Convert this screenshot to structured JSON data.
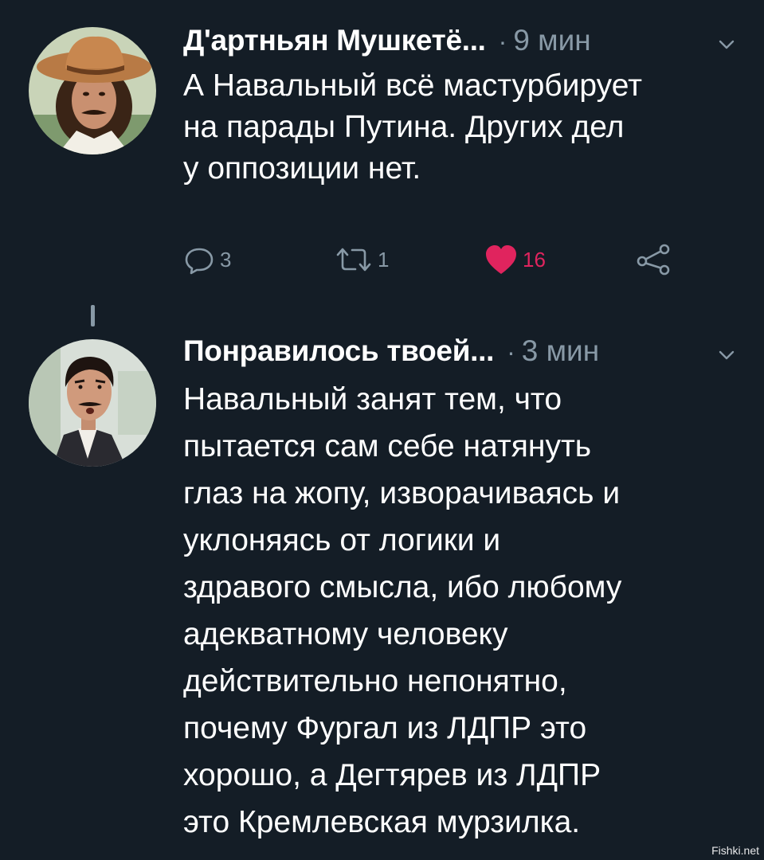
{
  "tweets": [
    {
      "author": "Д'артньян Мушкетё...",
      "separator": "·",
      "time": "9 мин",
      "lines": [
        "А Навальный всё мастурбирует",
        "на парады Путина. Других дел",
        "у оппозиции нет."
      ],
      "reply_count": "3",
      "retweet_count": "1",
      "like_count": "16"
    },
    {
      "author": "Понравилось твоей...",
      "separator": "·",
      "time": "3 мин",
      "lines": [
        "Навальный занят тем, что",
        "пытается сам себе натянуть",
        "глаз на жопу, изворачиваясь и",
        "уклоняясь от логики и",
        "здравого смысла, ибо любому",
        "адекватному человеку",
        "действительно непонятно,",
        "почему Фургал из ЛДПР это",
        "хорошо, а Дегтярев из ЛДПР",
        "это Кремлевская мурзилка."
      ]
    }
  ],
  "icons": {
    "reply": "reply-icon",
    "retweet": "retweet-icon",
    "like": "heart-icon",
    "share": "share-icon",
    "menu": "chevron-down-icon"
  },
  "colors": {
    "background": "#141d26",
    "muted": "#8899a6",
    "like": "#e0245e"
  },
  "watermark": "Fishki.net"
}
